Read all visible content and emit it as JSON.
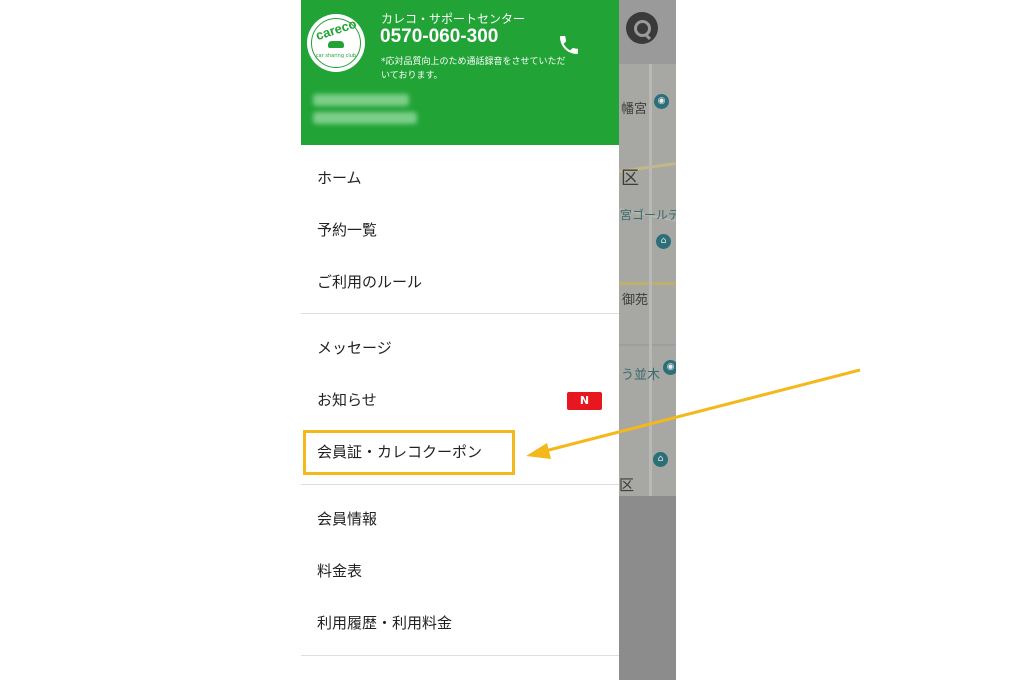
{
  "support": {
    "title": "カレコ・サポートセンター",
    "phone": "0570-060-300",
    "note": "*応対品質向上のため通話録音をさせていただいております。"
  },
  "logo": {
    "text": "careco",
    "tagline": "car sharing club"
  },
  "menu": {
    "home": "ホーム",
    "reservations": "予約一覧",
    "rules": "ご利用のルール",
    "messages": "メッセージ",
    "news": "お知らせ",
    "news_badge": "N",
    "member_card_coupon": "会員証・カレコクーポン",
    "member_info": "会員情報",
    "price_table": "料金表",
    "history_fees": "利用履歴・利用料金"
  },
  "map": {
    "labels": [
      "幡宮",
      "区",
      "宮ゴールデ",
      "御苑",
      "う並木",
      "区"
    ]
  },
  "colors": {
    "header_green": "#21a336",
    "badge_red": "#e8161e",
    "highlight_yellow": "#f4b71c"
  },
  "icons": {
    "phone": "phone-icon",
    "search": "search-icon",
    "arrow": "arrow-annotation"
  }
}
